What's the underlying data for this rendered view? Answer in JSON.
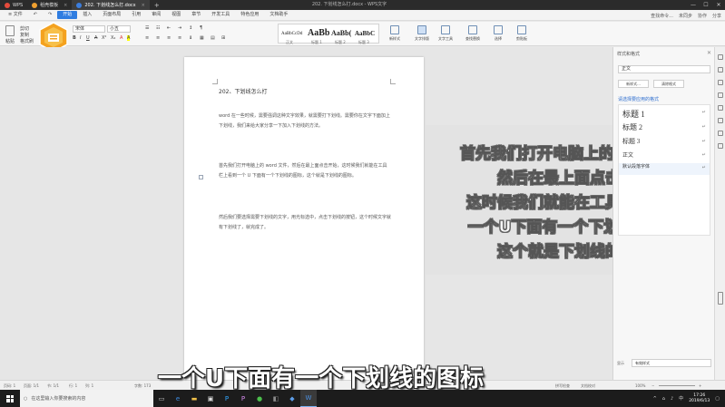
{
  "titlebar": {
    "tabs": [
      {
        "label": "WPS",
        "color": "#e54b3c"
      },
      {
        "label": "稻壳模板",
        "color": "#f0a030"
      },
      {
        "label": "202. 下划线怎么打.docx",
        "color": "#3b7ddd"
      }
    ],
    "plus": "+",
    "doc_title": "202. 下划线怎么打.docx - WPS文字",
    "min": "—",
    "max": "☐",
    "close": "✕"
  },
  "menubar": {
    "file": "≡ 文件",
    "items": [
      "开始",
      "插入",
      "页面布局",
      "引用",
      "审阅",
      "视图",
      "章节",
      "开发工具",
      "特色应用",
      "文档助手"
    ],
    "search": "查找命令...",
    "sync": "未同步",
    "share": "协作",
    "share2": "分享"
  },
  "ribbon": {
    "paste": "粘贴",
    "cut": "剪切",
    "copy": "复制",
    "format_painter": "格式刷",
    "font_name": "宋体",
    "font_size": "小五",
    "styles": [
      {
        "sample": "AaBbCcDd",
        "name": "正文"
      },
      {
        "sample": "AaBb",
        "name": "标题 1"
      },
      {
        "sample": "AaBb(",
        "name": "标题 2"
      },
      {
        "sample": "AaBbC",
        "name": "标题 3"
      }
    ],
    "new_style": "新样式",
    "text_toolbox": "文字排版",
    "find_replace": "查找替换",
    "select": "选择",
    "text_tools": "文字工具",
    "paste_clip": "剪贴板"
  },
  "document": {
    "title": "202、下划线怎么打",
    "para1": "word 在一些时候，需要强调这种文字效果，就需要打下划线。需要你在文字下面加上下划线，我们来给大家分享一下加入下划线的方法。",
    "para2": "首先我们打开电脑上的 word 文件，然后在最上面点击开始，这时候我们就能在工具栏上看到一个 U 下面有一个下划线的图标，这个就是下划线的图标。",
    "para3": "然后我们要选择需要下划线的文字，用光标选中，点击下划线的按钮，这个时候文字就有下划线了，就完成了。"
  },
  "overlay": {
    "lines": [
      "首先我们打开电脑上的word文件",
      "然后在最上面点击开始",
      "这时候我们就能在工具栏上看到",
      "一个U下面有一个下划线的图标",
      "这个就是下划线的图标"
    ]
  },
  "right_pane": {
    "header": "样式和格式",
    "close": "✕",
    "current_style": "正文",
    "btn_new": "新样式...",
    "btn_clear": "清除格式",
    "link": "请选择要应用的格式",
    "styles": [
      {
        "label": "标题 1",
        "size": "9px"
      },
      {
        "label": "标题 2",
        "size": "8px"
      },
      {
        "label": "标题 3",
        "size": "7px"
      },
      {
        "label": "正文",
        "size": "6px"
      },
      {
        "label": "默认段落字体",
        "size": "5px"
      }
    ],
    "show_label": "显示",
    "show_value": "有效样式"
  },
  "statusbar": {
    "page": "页码: 1",
    "pages": "页面: 1/1",
    "section": "节: 1/1",
    "row": "行: 1",
    "col": "列: 1",
    "words": "字数: 173",
    "spell": "拼写检查",
    "doc_check": "文档校对",
    "zoom": "100%"
  },
  "subtitle": "一个U下面有一个下划线的图标",
  "taskbar": {
    "search_placeholder": "在这里输入你要搜索的内容",
    "time": "17:26",
    "date": "2019/6/13",
    "lang": "中"
  }
}
